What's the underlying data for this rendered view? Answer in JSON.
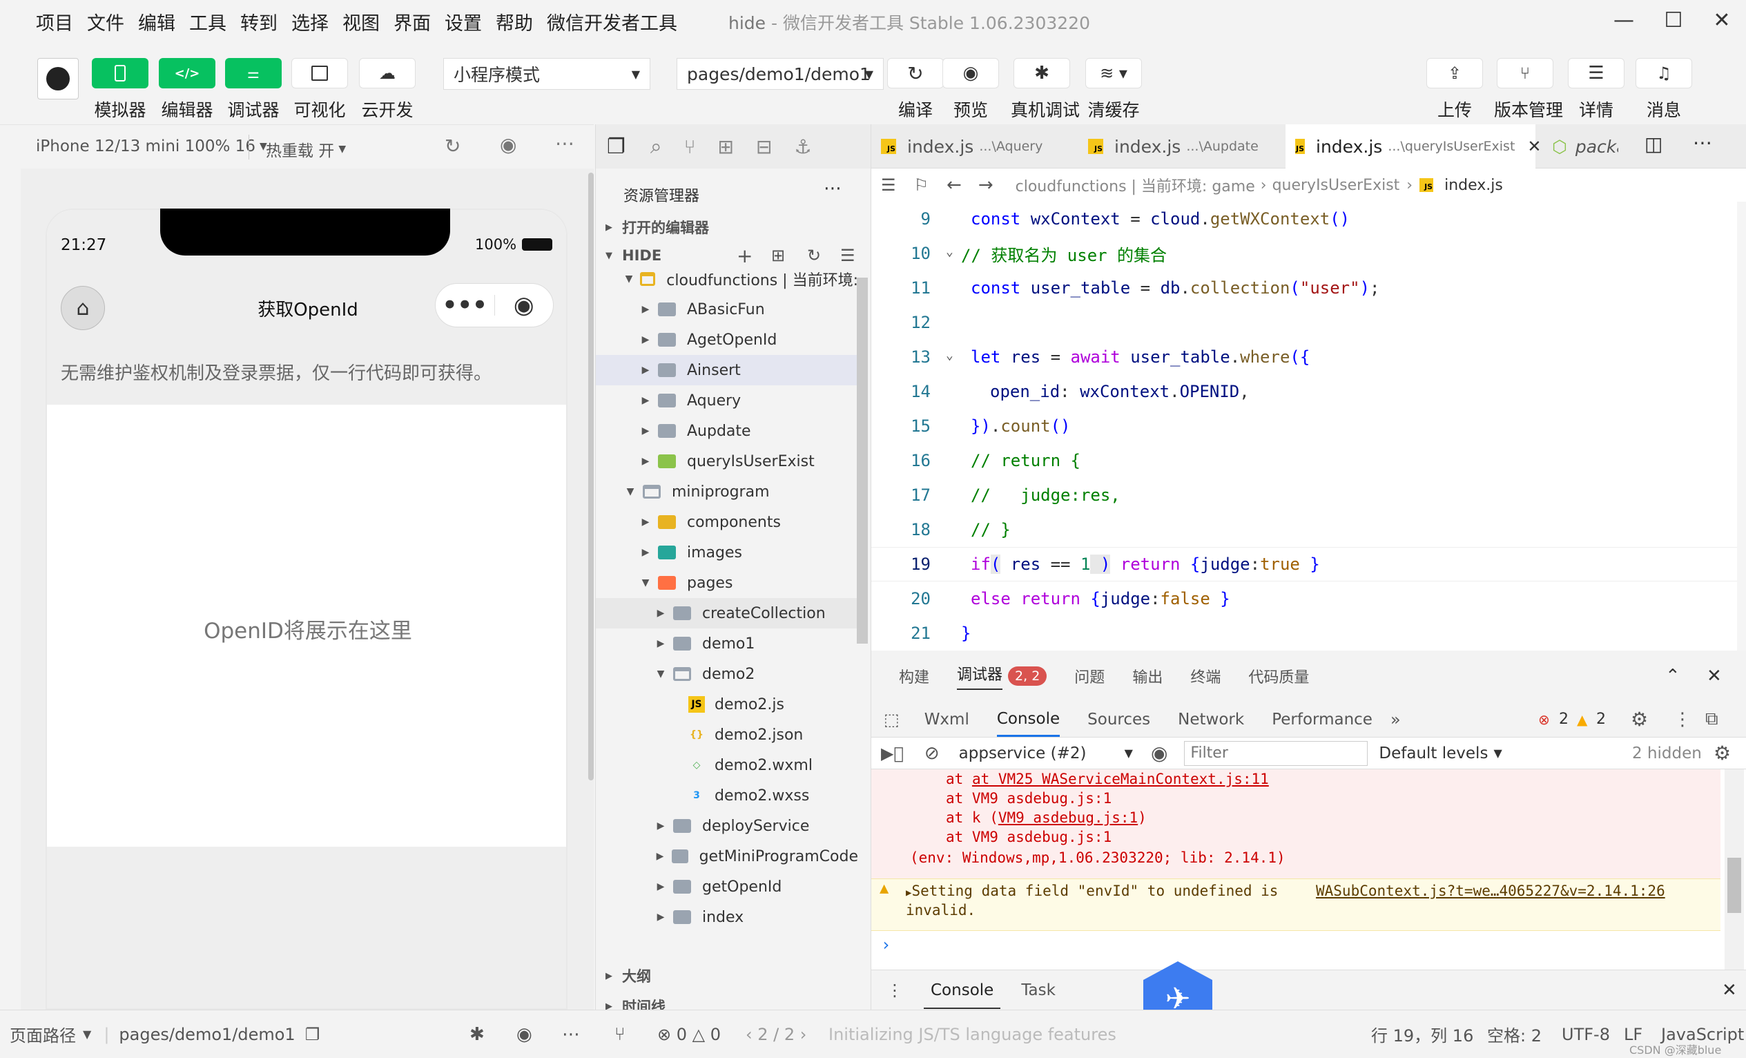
{
  "menubar": {
    "items": [
      "项目",
      "文件",
      "编辑",
      "工具",
      "转到",
      "选择",
      "视图",
      "界面",
      "设置",
      "帮助",
      "微信开发者工具"
    ],
    "title_app": "hide",
    "title_rest": " - 微信开发者工具 Stable 1.06.2303220"
  },
  "toolbar": {
    "simulator": "模拟器",
    "editor": "编辑器",
    "debugger": "调试器",
    "visual": "可视化",
    "cloud": "云开发",
    "mode": "小程序模式",
    "page_path": "pages/demo1/demo1",
    "compile": "编译",
    "preview": "预览",
    "real_debug": "真机调试",
    "clear_cache": "清缓存",
    "upload": "上传",
    "version": "版本管理",
    "details": "详情",
    "messages": "消息"
  },
  "simulator": {
    "device": "iPhone 12/13 mini 100% 16",
    "hot_reload": "热重载 开",
    "time": "21:27",
    "battery": "100%",
    "nav_title": "获取OpenId",
    "notice": "无需维护鉴权机制及登录票据，仅一行代码即可获得。",
    "placeholder": "OpenID将展示在这里"
  },
  "explorer": {
    "title": "资源管理器",
    "open_editors": "打开的编辑器",
    "project": "HIDE",
    "outline": "大纲",
    "timeline": "时间线",
    "tree": [
      {
        "label": "cloudfunctions | 当前环境: ",
        "depth": 0,
        "icon": "open-folder-yellow",
        "arrow": "▼"
      },
      {
        "label": "ABasicFun",
        "depth": 1,
        "icon": "folder-gray",
        "arrow": "▶"
      },
      {
        "label": "AgetOpenId",
        "depth": 1,
        "icon": "folder-gray",
        "arrow": "▶"
      },
      {
        "label": "Ainsert",
        "depth": 1,
        "icon": "folder-gray",
        "arrow": "▶"
      },
      {
        "label": "Aquery",
        "depth": 1,
        "icon": "folder-gray",
        "arrow": "▶"
      },
      {
        "label": "Aupdate",
        "depth": 1,
        "icon": "folder-gray",
        "arrow": "▶"
      },
      {
        "label": "queryIsUserExist",
        "depth": 1,
        "icon": "folder-green",
        "arrow": "▶"
      },
      {
        "label": "miniprogram",
        "depth": 0,
        "icon": "open-folder-gray",
        "arrow": "▼"
      },
      {
        "label": "components",
        "depth": 1,
        "icon": "folder-yellow",
        "arrow": "▶"
      },
      {
        "label": "images",
        "depth": 1,
        "icon": "folder-teal",
        "arrow": "▶"
      },
      {
        "label": "pages",
        "depth": 1,
        "icon": "folder-orange",
        "arrow": "▼"
      },
      {
        "label": "createCollection",
        "depth": 2,
        "icon": "folder-gray",
        "arrow": "▶"
      },
      {
        "label": "demo1",
        "depth": 2,
        "icon": "folder-gray",
        "arrow": "▶"
      },
      {
        "label": "demo2",
        "depth": 2,
        "icon": "open-folder-gray",
        "arrow": "▼"
      },
      {
        "label": "demo2.js",
        "depth": 3,
        "icon": "js-file",
        "arrow": ""
      },
      {
        "label": "demo2.json",
        "depth": 3,
        "icon": "json-file",
        "arrow": ""
      },
      {
        "label": "demo2.wxml",
        "depth": 3,
        "icon": "wxml-file",
        "arrow": ""
      },
      {
        "label": "demo2.wxss",
        "depth": 3,
        "icon": "wxss-file",
        "arrow": ""
      },
      {
        "label": "deployService",
        "depth": 2,
        "icon": "folder-gray",
        "arrow": "▶"
      },
      {
        "label": "getMiniProgramCode",
        "depth": 2,
        "icon": "folder-gray",
        "arrow": "▶"
      },
      {
        "label": "getOpenId",
        "depth": 2,
        "icon": "folder-gray",
        "arrow": "▶"
      },
      {
        "label": "index",
        "depth": 2,
        "icon": "folder-gray",
        "arrow": "▶"
      }
    ]
  },
  "tabs": [
    {
      "name": "index.js",
      "path": "...\\Aquery"
    },
    {
      "name": "index.js",
      "path": "...\\Aupdate"
    },
    {
      "name": "index.js",
      "path": "...\\queryIsUserExist"
    },
    {
      "name": "packa",
      "path": ""
    }
  ],
  "breadcrumbs": {
    "c1": "cloudfunctions | 当前环境: game",
    "c2": "queryIsUserExist",
    "c3": "index.js"
  },
  "code": {
    "l9": "9",
    "l10": "10",
    "l11": "11",
    "l12": "12",
    "l13": "13",
    "l14": "14",
    "l15": "15",
    "l16": "16",
    "l17": "17",
    "l18": "18",
    "l19": "19",
    "l20": "20",
    "l21": "21"
  },
  "panel": {
    "tabs": [
      "构建",
      "调试器",
      "问题",
      "输出",
      "终端",
      "代码质量"
    ],
    "badge": "2, 2",
    "devtools_tabs": [
      "Wxml",
      "Console",
      "Sources",
      "Network",
      "Performance"
    ],
    "errors": "2",
    "warnings": "2",
    "context": "appservice (#2)",
    "filter_placeholder": "Filter",
    "levels": "Default levels",
    "hidden": "2 hidden",
    "log": {
      "l1": "at VM25 WAServiceMainContext.js:11",
      "l2": "at VM9 asdebug.js:1",
      "l3a": "at k (",
      "l3b": "VM9 asdebug.js:1",
      "l3c": ")",
      "l4": "at VM9 asdebug.js:1",
      "l5": "(env: Windows,mp,1.06.2303220; lib: 2.14.1)",
      "warn": "Setting data field \"envId\" to undefined is",
      "warn_link": "WASubContext.js?t=we…4065227&v=2.14.1:26",
      "warn2": "invalid."
    },
    "drawer_tabs": [
      "Console",
      "Task"
    ]
  },
  "status": {
    "page_path_label": "页面路径",
    "page_path": "pages/demo1/demo1",
    "errors": "0",
    "warnings": "0",
    "pager": "2 / 2",
    "message": "Initializing JS/TS language features",
    "cursor": "行 19，列 16",
    "spaces": "空格: 2",
    "encoding": "UTF-8",
    "eol": "LF",
    "language": "JavaScript",
    "watermark": "CSDN @深藏blue"
  }
}
